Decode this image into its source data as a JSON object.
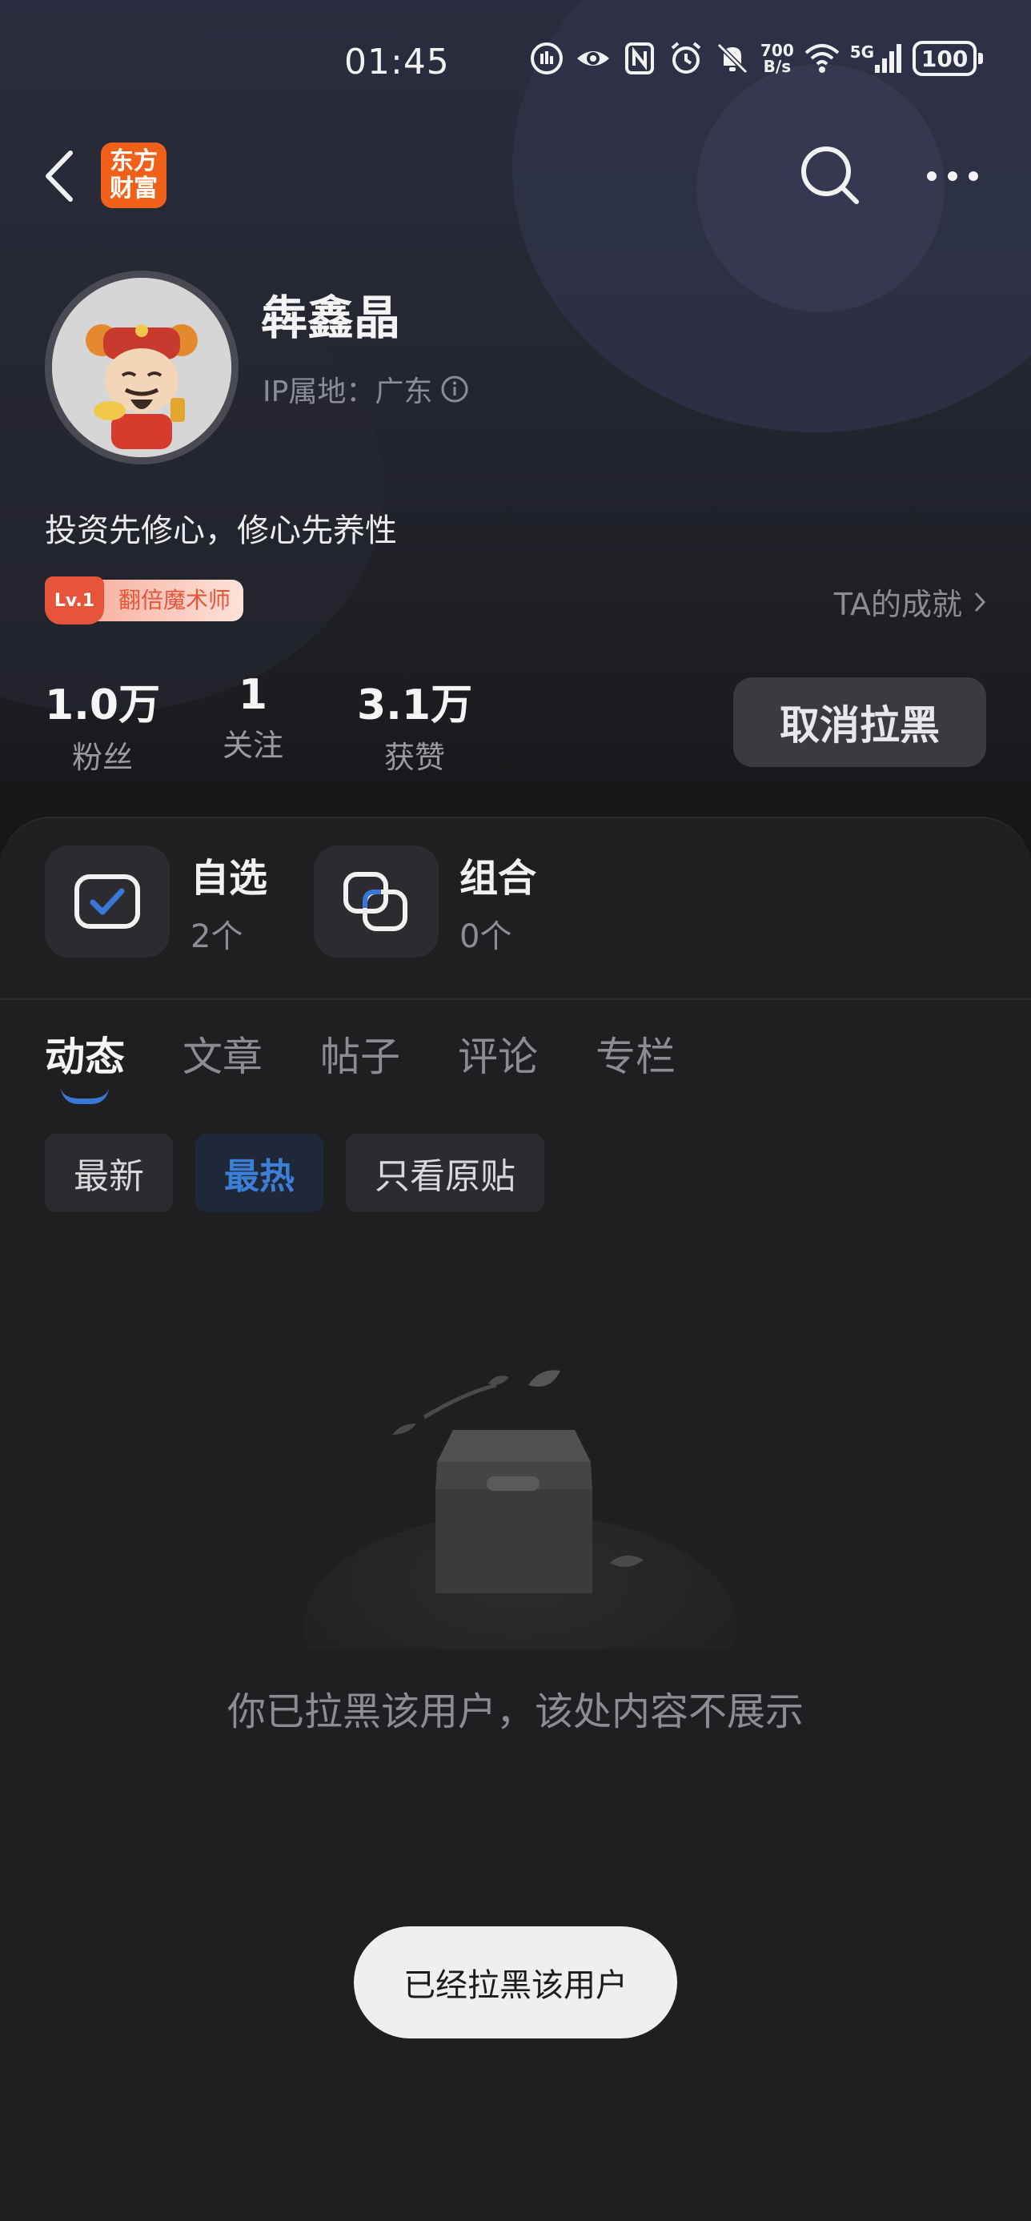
{
  "status_bar": {
    "time": "01:45",
    "net_speed_value": "700",
    "net_speed_unit": "B/s",
    "network": "5G",
    "battery": "100"
  },
  "nav": {
    "logo_line1": "东方",
    "logo_line2": "财富"
  },
  "profile": {
    "name": "犇鑫晶",
    "ip_location": "IP属地：广东",
    "bio": "投资先修心，修心先养性",
    "badge_level": "Lv.1",
    "badge_title": "翻倍魔术师",
    "achievements_link": "TA的成就"
  },
  "stats": [
    {
      "value": "1.0万",
      "label": "粉丝"
    },
    {
      "value": "1",
      "label": "关注"
    },
    {
      "value": "3.1万",
      "label": "获赞"
    }
  ],
  "unblock_button": "取消拉黑",
  "quick_items": [
    {
      "title": "自选",
      "count": "2个"
    },
    {
      "title": "组合",
      "count": "0个"
    }
  ],
  "tabs": [
    "动态",
    "文章",
    "帖子",
    "评论",
    "专栏"
  ],
  "active_tab": "动态",
  "filters": [
    "最新",
    "最热",
    "只看原贴"
  ],
  "active_filter": "最热",
  "empty_message": "你已拉黑该用户，该处内容不展示",
  "toast": "已经拉黑该用户",
  "colors": {
    "accent_blue": "#3a78d8",
    "logo_orange": "#f06018",
    "badge_red": "#e6543a"
  }
}
